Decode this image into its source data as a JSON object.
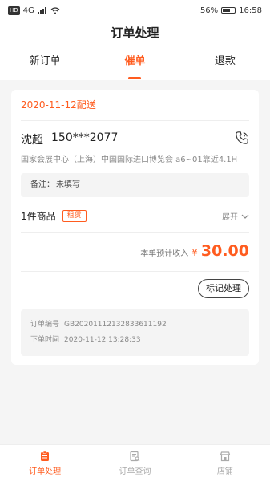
{
  "status_bar": {
    "signal_text": "4G",
    "battery": "56%",
    "time": "16:58",
    "hd": "HD"
  },
  "header": {
    "title": "订单处理"
  },
  "tabs": [
    {
      "label": "新订单",
      "active": false
    },
    {
      "label": "催单",
      "active": true
    },
    {
      "label": "退款",
      "active": false
    }
  ],
  "order": {
    "delivery": "2020-11-12配送",
    "customer_name": "沈超",
    "customer_phone": "150***2077",
    "address": "国家会展中心（上海）中国国际进口博览会 a6~01靠近4.1H",
    "remark_label": "备注：",
    "remark_value": "未填写",
    "goods_count": "1件商品",
    "goods_tag": "租赁",
    "expand_label": "展开",
    "income_label": "本单预计收入",
    "income_currency": "¥",
    "income_amount": "30.00",
    "mark_button": "标记处理",
    "order_no_label": "订单编号",
    "order_no": "GB20201112132833611192",
    "order_time_label": "下单时间",
    "order_time": "2020-11-12 13:28:33"
  },
  "bottom_nav": [
    {
      "label": "订单处理",
      "icon": "clipboard-icon",
      "active": true
    },
    {
      "label": "订单查询",
      "icon": "document-search-icon",
      "active": false
    },
    {
      "label": "店铺",
      "icon": "store-icon",
      "active": false
    }
  ],
  "colors": {
    "accent": "#ff5c1f",
    "background": "#f5f5f5"
  }
}
